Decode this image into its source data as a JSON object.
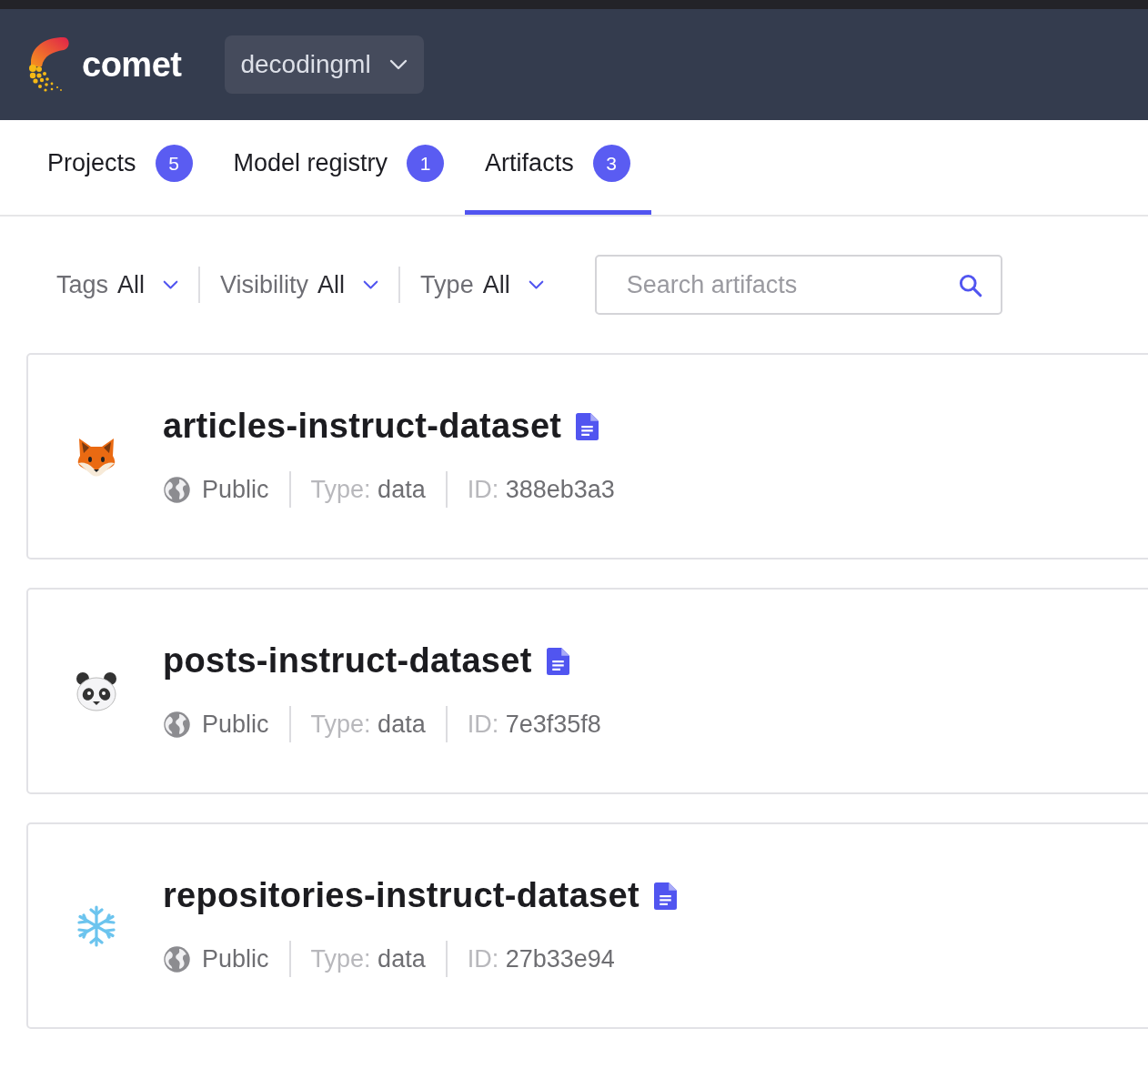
{
  "header": {
    "brand": "comet",
    "workspace": "decodingml"
  },
  "tabs": [
    {
      "label": "Projects",
      "count": "5",
      "selected": false
    },
    {
      "label": "Model registry",
      "count": "1",
      "selected": false
    },
    {
      "label": "Artifacts",
      "count": "3",
      "selected": true
    }
  ],
  "filters": [
    {
      "label": "Tags",
      "value": "All"
    },
    {
      "label": "Visibility",
      "value": "All"
    },
    {
      "label": "Type",
      "value": "All"
    }
  ],
  "search": {
    "placeholder": "Search artifacts"
  },
  "artifacts": [
    {
      "kind": "fox",
      "name": "articles-instruct-dataset",
      "visibility": "Public",
      "type_label": "Type:",
      "type": "data",
      "id_label": "ID:",
      "id": "388eb3a3"
    },
    {
      "kind": "panda",
      "name": "posts-instruct-dataset",
      "visibility": "Public",
      "type_label": "Type:",
      "type": "data",
      "id_label": "ID:",
      "id": "7e3f35f8"
    },
    {
      "kind": "snowflake",
      "name": "repositories-instruct-dataset",
      "visibility": "Public",
      "type_label": "Type:",
      "type": "data",
      "id_label": "ID:",
      "id": "27b33e94"
    }
  ]
}
